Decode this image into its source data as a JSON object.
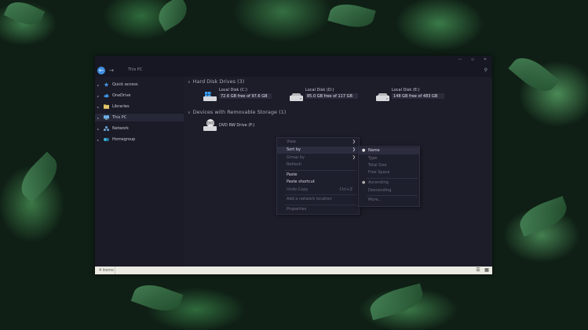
{
  "window": {
    "address": "This PC",
    "controls": [
      "—",
      "▫",
      "✕"
    ]
  },
  "sidebar": {
    "items": [
      {
        "label": "Quick access",
        "icon": "star-icon",
        "color": "#4a9cf0"
      },
      {
        "label": "OneDrive",
        "icon": "cloud-icon",
        "color": "#3f8fe0"
      },
      {
        "label": "Libraries",
        "icon": "folder-icon",
        "color": "#e2c56a"
      },
      {
        "label": "This PC",
        "icon": "monitor-icon",
        "color": "#6fb0e8"
      },
      {
        "label": "Network",
        "icon": "network-icon",
        "color": "#6fb0e8"
      },
      {
        "label": "Homegroup",
        "icon": "homegroup-icon",
        "color": "#3fb0d8"
      }
    ]
  },
  "content": {
    "group_hdd": "Hard Disk Drives (3)",
    "group_removable": "Devices with Removable Storage (1)",
    "drives": [
      {
        "name": "Local Disk (C:)",
        "space": "72.6 GB free of 97.6 GB",
        "icon": "windows-drive-icon"
      },
      {
        "name": "Local Disk (D:)",
        "space": "85.0 GB free of 117 GB",
        "icon": "hard-drive-icon"
      },
      {
        "name": "Local Disk (E:)",
        "space": "148 GB free of 483 GB",
        "icon": "hard-drive-icon"
      }
    ],
    "dvd": {
      "name": "DVD RW Drive (F:)",
      "icon": "dvd-drive-icon"
    }
  },
  "context_menu": {
    "view": "View",
    "sort_by": "Sort by",
    "group_by": "Group by",
    "refresh": "Refresh",
    "paste": "Paste",
    "paste_shortcut": "Paste shortcut",
    "undo_copy": "Undo Copy",
    "undo_shortcut": "Ctrl+Z",
    "add_network": "Add a network location",
    "properties": "Properties"
  },
  "submenu": {
    "name": "Name",
    "type": "Type",
    "total_size": "Total Size",
    "free_space": "Free Space",
    "ascending": "Ascending",
    "descending": "Descending",
    "more": "More..."
  },
  "status": {
    "items": "4 items"
  }
}
